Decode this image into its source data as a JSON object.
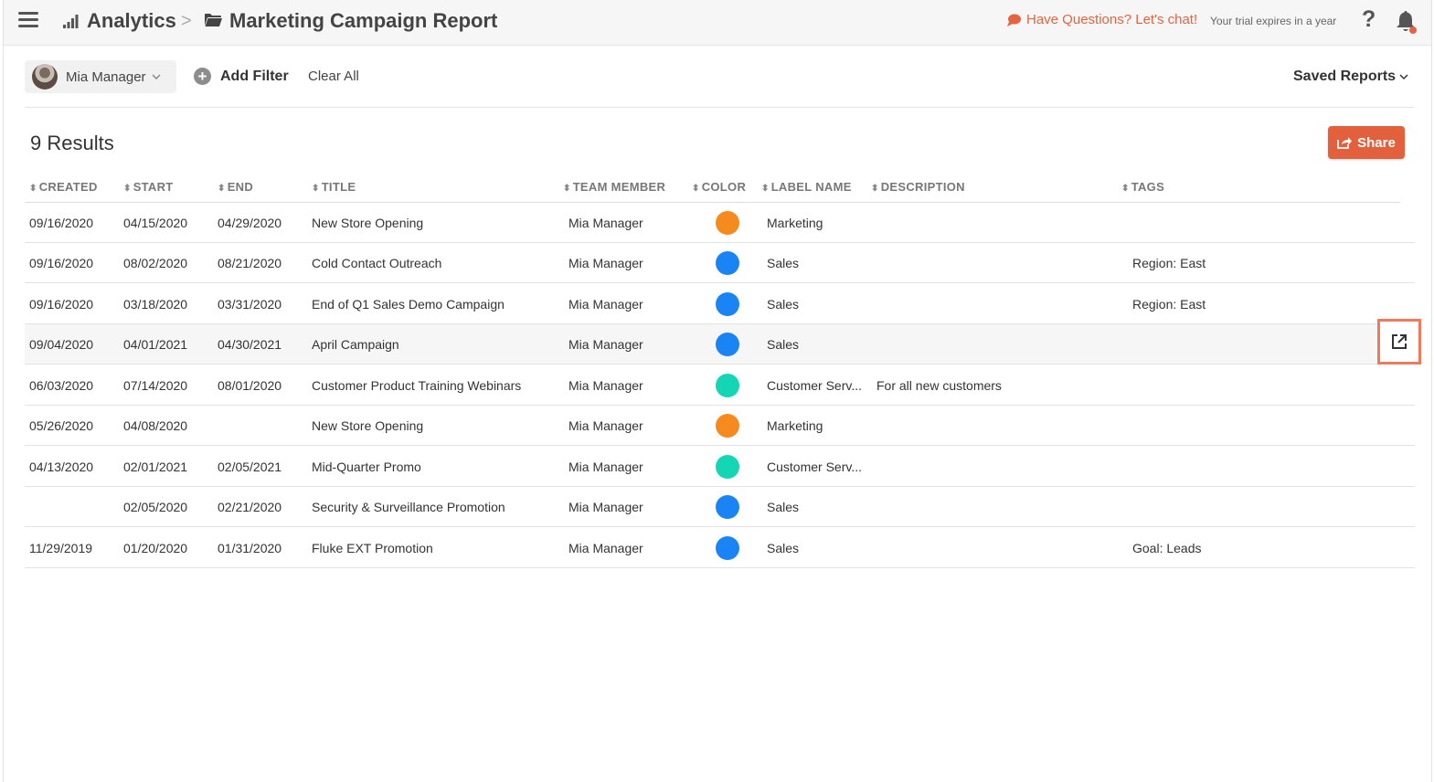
{
  "header": {
    "breadcrumb_root": "Analytics",
    "breadcrumb_separator": ">",
    "report_title": "Marketing Campaign Report",
    "chat_link": "Have Questions? Let's chat!",
    "trial_notice": "Your trial expires in a year",
    "help_label": "?"
  },
  "filters": {
    "user": "Mia Manager",
    "add_filter": "Add Filter",
    "clear_all": "Clear All",
    "saved_reports": "Saved Reports"
  },
  "results": {
    "count_label": "9 Results",
    "share_label": "Share"
  },
  "table": {
    "columns": [
      "CREATED",
      "START",
      "END",
      "TITLE",
      "TEAM MEMBER",
      "COLOR",
      "LABEL NAME",
      "DESCRIPTION",
      "TAGS"
    ],
    "rows": [
      {
        "created": "09/16/2020",
        "start": "04/15/2020",
        "end": "04/29/2020",
        "title": "New Store Opening",
        "member": "Mia Manager",
        "color": "#f58a1f",
        "label": "Marketing",
        "description": "",
        "tags": ""
      },
      {
        "created": "09/16/2020",
        "start": "08/02/2020",
        "end": "08/21/2020",
        "title": "Cold Contact Outreach",
        "member": "Mia Manager",
        "color": "#1b84f5",
        "label": "Sales",
        "description": "",
        "tags": "Region: East"
      },
      {
        "created": "09/16/2020",
        "start": "03/18/2020",
        "end": "03/31/2020",
        "title": "End of Q1 Sales Demo Campaign",
        "member": "Mia Manager",
        "color": "#1b84f5",
        "label": "Sales",
        "description": "",
        "tags": "Region: East"
      },
      {
        "created": "09/04/2020",
        "start": "04/01/2021",
        "end": "04/30/2021",
        "title": "April Campaign",
        "member": "Mia Manager",
        "color": "#1b84f5",
        "label": "Sales",
        "description": "",
        "tags": ""
      },
      {
        "created": "06/03/2020",
        "start": "07/14/2020",
        "end": "08/01/2020",
        "title": "Customer Product Training Webinars",
        "member": "Mia Manager",
        "color": "#14d6b4",
        "label": "Customer Serv...",
        "description": "For all new customers",
        "tags": ""
      },
      {
        "created": "05/26/2020",
        "start": "04/08/2020",
        "end": "",
        "title": "New Store Opening",
        "member": "Mia Manager",
        "color": "#f58a1f",
        "label": "Marketing",
        "description": "",
        "tags": ""
      },
      {
        "created": "04/13/2020",
        "start": "02/01/2021",
        "end": "02/05/2021",
        "title": "Mid-Quarter Promo",
        "member": "Mia Manager",
        "color": "#14d6b4",
        "label": "Customer Serv...",
        "description": "",
        "tags": ""
      },
      {
        "created": "",
        "start": "02/05/2020",
        "end": "02/21/2020",
        "title": "Security & Surveillance Promotion",
        "member": "Mia Manager",
        "color": "#1b84f5",
        "label": "Sales",
        "description": "",
        "tags": ""
      },
      {
        "created": "11/29/2019",
        "start": "01/20/2020",
        "end": "01/31/2020",
        "title": "Fluke EXT Promotion",
        "member": "Mia Manager",
        "color": "#1b84f5",
        "label": "Sales",
        "description": "",
        "tags": "Goal: Leads"
      }
    ],
    "highlighted_row": 3
  },
  "colors": {
    "accent": "#e2603c",
    "chat": "#e4643f",
    "highlight_border": "#ef7a5a",
    "notification_dot": "#e4643f"
  },
  "icons": [
    "menu-icon",
    "bar-chart-icon",
    "folder-icon",
    "chat-bubble-icon",
    "help-icon",
    "bell-icon",
    "chevron-down-icon",
    "plus-circle-icon",
    "share-icon",
    "external-link-icon",
    "sort-icon"
  ]
}
